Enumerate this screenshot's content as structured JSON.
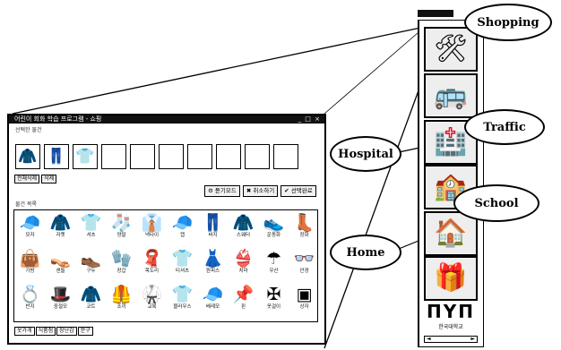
{
  "window": {
    "title": "어린이 회화 학습 프로그램 - 쇼핑",
    "controls": "_ □ ×",
    "section_selected": "선택한 물건",
    "section_items": "물건 목록",
    "small_buttons": [
      "전체삭제",
      "삭제"
    ],
    "action_buttons": [
      {
        "icon": "⚙",
        "label": "듣기모드"
      },
      {
        "icon": "✖",
        "label": "취소하기"
      },
      {
        "icon": "✔",
        "label": "선택완료"
      }
    ],
    "bottom_tabs": [
      "옷가게",
      "식품점",
      "장난감",
      "문구"
    ]
  },
  "selected_slots": [
    {
      "icon": "coat-icon",
      "glyph": "🧥"
    },
    {
      "icon": "pants-icon",
      "glyph": "👖"
    },
    {
      "icon": "shirt-icon",
      "glyph": "👕"
    },
    {
      "icon": "",
      "glyph": ""
    },
    {
      "icon": "",
      "glyph": ""
    },
    {
      "icon": "",
      "glyph": ""
    },
    {
      "icon": "",
      "glyph": ""
    },
    {
      "icon": "",
      "glyph": ""
    },
    {
      "icon": "",
      "glyph": ""
    },
    {
      "icon": "",
      "glyph": ""
    }
  ],
  "items": [
    {
      "icon": "hat-icon",
      "glyph": "🧢",
      "label": "모자"
    },
    {
      "icon": "jacket-icon",
      "glyph": "🧥",
      "label": "자켓"
    },
    {
      "icon": "shirt-icon",
      "glyph": "👕",
      "label": "셔츠"
    },
    {
      "icon": "sock-icon",
      "glyph": "🧦",
      "label": "양말"
    },
    {
      "icon": "tie-icon",
      "glyph": "👔",
      "label": "넥타이"
    },
    {
      "icon": "cap-icon",
      "glyph": "🧢",
      "label": "캡"
    },
    {
      "icon": "pants-icon",
      "glyph": "👖",
      "label": "바지"
    },
    {
      "icon": "sweater-icon",
      "glyph": "🧥",
      "label": "스웨터"
    },
    {
      "icon": "shoe-icon",
      "glyph": "👟",
      "label": "운동화"
    },
    {
      "icon": "boot-icon",
      "glyph": "👢",
      "label": "장화"
    },
    {
      "icon": "bag-icon",
      "glyph": "👜",
      "label": "가방"
    },
    {
      "icon": "sandal-icon",
      "glyph": "👡",
      "label": "샌들"
    },
    {
      "icon": "shoe-icon",
      "glyph": "👞",
      "label": "구두"
    },
    {
      "icon": "glove-icon",
      "glyph": "🧤",
      "label": "장갑"
    },
    {
      "icon": "scarf-icon",
      "glyph": "🧣",
      "label": "목도리"
    },
    {
      "icon": "shirt-icon",
      "glyph": "👕",
      "label": "티셔츠"
    },
    {
      "icon": "dress-icon",
      "glyph": "👗",
      "label": "원피스"
    },
    {
      "icon": "skirt-icon",
      "glyph": "👙",
      "label": "치마"
    },
    {
      "icon": "umbrella-icon",
      "glyph": "☂",
      "label": "우산"
    },
    {
      "icon": "glasses-icon",
      "glyph": "👓",
      "label": "안경"
    },
    {
      "icon": "ring-icon",
      "glyph": "💍",
      "label": "반지"
    },
    {
      "icon": "hat-icon",
      "glyph": "🎩",
      "label": "중절모"
    },
    {
      "icon": "coat-icon",
      "glyph": "🧥",
      "label": "코트"
    },
    {
      "icon": "vest-icon",
      "glyph": "🦺",
      "label": "조끼"
    },
    {
      "icon": "uniform-icon",
      "glyph": "🥋",
      "label": "교복"
    },
    {
      "icon": "shirt-icon",
      "glyph": "👕",
      "label": "블라우스"
    },
    {
      "icon": "cap-icon",
      "glyph": "🧢",
      "label": "베레모"
    },
    {
      "icon": "pin-icon",
      "glyph": "📌",
      "label": "핀"
    },
    {
      "icon": "hanger-icon",
      "glyph": "✠",
      "label": "옷걸이"
    },
    {
      "icon": "box-icon",
      "glyph": "▣",
      "label": "상자"
    }
  ],
  "panel": {
    "icons": [
      {
        "name": "shopping-icon",
        "glyph": "🛠"
      },
      {
        "name": "traffic-icon",
        "glyph": "🚌"
      },
      {
        "name": "hospital-icon",
        "glyph": "🏥"
      },
      {
        "name": "school-icon",
        "glyph": "🏫"
      },
      {
        "name": "home-icon",
        "glyph": "🏠"
      },
      {
        "name": "misc-icon",
        "glyph": "🎁"
      }
    ],
    "logo": "ΠΥΠ",
    "logo_sub": "한국대학교",
    "scroll_left": "◄",
    "scroll_right": "►"
  },
  "callouts": {
    "shopping": "Shopping",
    "traffic": "Traffic",
    "hospital": "Hospital",
    "school": "School",
    "home": "Home"
  }
}
